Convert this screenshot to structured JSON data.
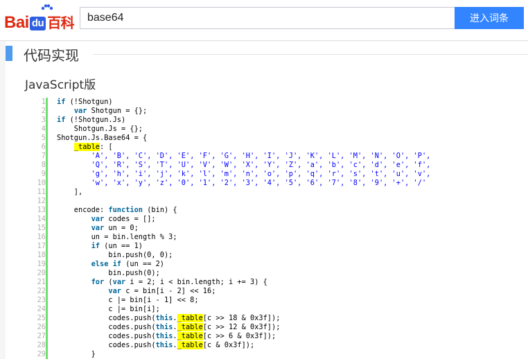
{
  "header": {
    "logo": {
      "bai": "Bai",
      "du": "du",
      "baike": "百科"
    },
    "search": {
      "value": "base64"
    },
    "submit_label": "进入词条"
  },
  "section": {
    "title": "代码实现",
    "subtitle": "JavaScript版"
  },
  "code": {
    "line_numbers": [
      "1",
      "2",
      "3",
      "4",
      "5",
      "6",
      "7",
      "8",
      "9",
      "10",
      "11",
      "12",
      "13",
      "14",
      "15",
      "16",
      "17",
      "18",
      "19",
      "20",
      "21",
      "22",
      "23",
      "24",
      "25",
      "26",
      "27",
      "28",
      "29"
    ],
    "lines": [
      [
        {
          "t": "if",
          "c": "kw"
        },
        {
          "t": " (!Shotgun)"
        }
      ],
      [
        {
          "t": "    "
        },
        {
          "t": "var",
          "c": "kw"
        },
        {
          "t": " Shotgun = {};"
        }
      ],
      [
        {
          "t": "if",
          "c": "kw"
        },
        {
          "t": " (!Shotgun.Js)"
        }
      ],
      [
        {
          "t": "    Shotgun.Js = {};"
        }
      ],
      [
        {
          "t": "Shotgun.Js.Base64 = {"
        }
      ],
      [
        {
          "t": "    "
        },
        {
          "t": "_table",
          "c": "hl"
        },
        {
          "t": ": ["
        }
      ],
      [
        {
          "t": "        "
        },
        {
          "t": "'A', 'B', 'C', 'D', 'E', 'F', 'G', 'H', 'I', 'J', 'K', 'L', 'M', 'N', 'O', 'P',",
          "c": "str"
        }
      ],
      [
        {
          "t": "        "
        },
        {
          "t": "'Q', 'R', 'S', 'T', 'U', 'V', 'W', 'X', 'Y', 'Z', 'a', 'b', 'c', 'd', 'e', 'f',",
          "c": "str"
        }
      ],
      [
        {
          "t": "        "
        },
        {
          "t": "'g', 'h', 'i', 'j', 'k', 'l', 'm', 'n', 'o', 'p', 'q', 'r', 's', 't', 'u', 'v',",
          "c": "str"
        }
      ],
      [
        {
          "t": "        "
        },
        {
          "t": "'w', 'x', 'y', 'z', '0', '1', '2', '3', '4', '5', '6', '7', '8', '9', '+', '/'",
          "c": "str"
        }
      ],
      [
        {
          "t": "    ],"
        }
      ],
      [
        {
          "t": ""
        }
      ],
      [
        {
          "t": "    encode: "
        },
        {
          "t": "function",
          "c": "kw"
        },
        {
          "t": " (bin) {"
        }
      ],
      [
        {
          "t": "        "
        },
        {
          "t": "var",
          "c": "kw"
        },
        {
          "t": " codes = [];"
        }
      ],
      [
        {
          "t": "        "
        },
        {
          "t": "var",
          "c": "kw"
        },
        {
          "t": " un = 0;"
        }
      ],
      [
        {
          "t": "        un = bin.length % 3;"
        }
      ],
      [
        {
          "t": "        "
        },
        {
          "t": "if",
          "c": "kw"
        },
        {
          "t": " (un == 1)"
        }
      ],
      [
        {
          "t": "            bin.push(0, 0);"
        }
      ],
      [
        {
          "t": "        "
        },
        {
          "t": "else if",
          "c": "kw"
        },
        {
          "t": " (un == 2)"
        }
      ],
      [
        {
          "t": "            bin.push(0);"
        }
      ],
      [
        {
          "t": "        "
        },
        {
          "t": "for",
          "c": "kw"
        },
        {
          "t": " ("
        },
        {
          "t": "var",
          "c": "kw"
        },
        {
          "t": " i = 2; i < bin.length; i += 3) {"
        }
      ],
      [
        {
          "t": "            "
        },
        {
          "t": "var",
          "c": "kw"
        },
        {
          "t": " c = bin[i - 2] << 16;"
        }
      ],
      [
        {
          "t": "            c |= bin[i - 1] << 8;"
        }
      ],
      [
        {
          "t": "            c |= bin[i];"
        }
      ],
      [
        {
          "t": "            codes.push("
        },
        {
          "t": "this",
          "c": "kw"
        },
        {
          "t": "."
        },
        {
          "t": "_table",
          "c": "hl"
        },
        {
          "t": "[c >> 18 & 0x3f]);"
        }
      ],
      [
        {
          "t": "            codes.push("
        },
        {
          "t": "this",
          "c": "kw"
        },
        {
          "t": "."
        },
        {
          "t": "_table",
          "c": "hl"
        },
        {
          "t": "[c >> 12 & 0x3f]);"
        }
      ],
      [
        {
          "t": "            codes.push("
        },
        {
          "t": "this",
          "c": "kw"
        },
        {
          "t": "."
        },
        {
          "t": "_table",
          "c": "hl"
        },
        {
          "t": "[c >> 6 & 0x3f]);"
        }
      ],
      [
        {
          "t": "            codes.push("
        },
        {
          "t": "this",
          "c": "kw"
        },
        {
          "t": "."
        },
        {
          "t": "_table",
          "c": "hl"
        },
        {
          "t": "[c & 0x3f]);"
        }
      ],
      [
        {
          "t": "        }"
        }
      ]
    ]
  },
  "colors": {
    "brand_red": "#de2910",
    "brand_blue": "#2e5fe0",
    "button_blue": "#3385ff",
    "section_bar": "#4f9cee",
    "keyword": "#006699",
    "string": "#0000ff",
    "highlight": "#ffff00",
    "gutter_rule": "#6ce26c"
  },
  "icons": {
    "logo_paw": "paw-icon"
  }
}
